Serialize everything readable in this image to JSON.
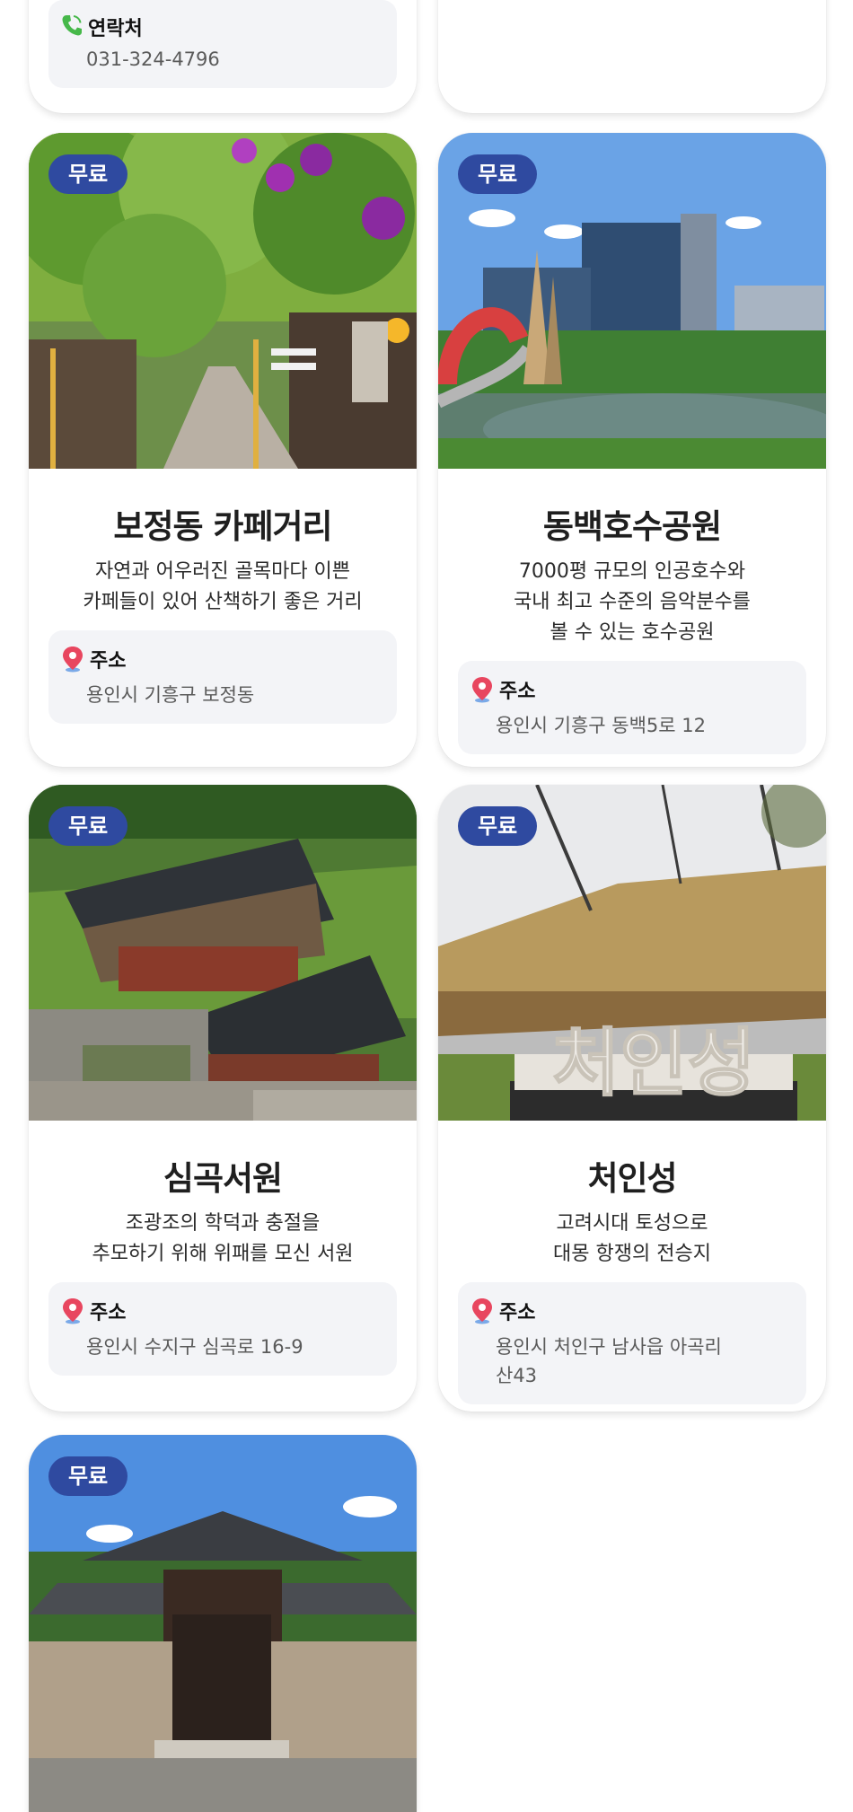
{
  "top_left_card": {
    "contact_label": "연락처",
    "contact_value": "031-324-4796"
  },
  "cards": [
    {
      "badge": "무료",
      "title": "보정동 카페거리",
      "description": "자연과 어우러진 골목마다 이쁜\n카페들이 있어 산책하기 좋은 거리",
      "address_label": "주소",
      "address_value": "용인시 기흥구 보정동"
    },
    {
      "badge": "무료",
      "title": "동백호수공원",
      "description": "7000평 규모의 인공호수와\n국내 최고 수준의 음악분수를\n볼 수 있는 호수공원",
      "address_label": "주소",
      "address_value": "용인시 기흥구 동백5로 12"
    },
    {
      "badge": "무료",
      "title": "심곡서원",
      "description": "조광조의 학덕과 충절을\n추모하기 위해 위패를 모신 서원",
      "address_label": "주소",
      "address_value": "용인시 수지구 심곡로 16-9"
    },
    {
      "badge": "무료",
      "title": "처인성",
      "description": "고려시대 토성으로\n대몽 항쟁의 전승지",
      "address_label": "주소",
      "address_value": "용인시 처인구 남사읍 아곡리\n산43",
      "photo_sign_text": "처인성"
    },
    {
      "badge": "무료"
    }
  ],
  "colors": {
    "badge": "#2f4aa0",
    "info_bg": "#f3f4f7",
    "pin": "#e8465f",
    "phone": "#46b84a"
  },
  "icons": {
    "phone": "phone-icon",
    "pin": "location-pin-icon"
  }
}
